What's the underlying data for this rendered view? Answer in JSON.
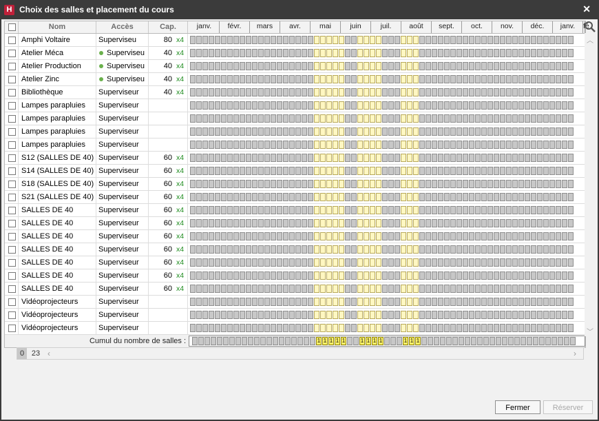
{
  "window": {
    "title": "Choix des salles et placement du cours",
    "app_icon": "H",
    "close_label": "✕"
  },
  "columns": {
    "name": "Nom",
    "access": "Accès",
    "capacity": "Cap."
  },
  "months": [
    "janv.",
    "févr.",
    "mars",
    "avr.",
    "mai",
    "juin",
    "juil.",
    "août",
    "sept.",
    "oct.",
    "nov.",
    "déc.",
    "janv.",
    "fé"
  ],
  "rows": [
    {
      "name": "Amphi Voltaire",
      "access": "Superviseu",
      "dot": false,
      "cap": "80",
      "mult": "x4",
      "active": true
    },
    {
      "name": "Atelier Méca",
      "access": "Superviseu",
      "dot": true,
      "cap": "40",
      "mult": "x4",
      "active": true
    },
    {
      "name": "Atelier Production",
      "access": "Superviseu",
      "dot": true,
      "cap": "40",
      "mult": "x4",
      "active": true
    },
    {
      "name": "Atelier Zinc",
      "access": "Superviseu",
      "dot": true,
      "cap": "40",
      "mult": "x4",
      "active": true
    },
    {
      "name": "Bibliothèque",
      "access": "Superviseur",
      "dot": false,
      "cap": "40",
      "mult": "x4",
      "active": true
    },
    {
      "name": "Lampes parapluies",
      "access": "Superviseur",
      "dot": false,
      "cap": "",
      "mult": "",
      "active": true
    },
    {
      "name": "Lampes parapluies",
      "access": "Superviseur",
      "dot": false,
      "cap": "",
      "mult": "",
      "active": true
    },
    {
      "name": "Lampes parapluies",
      "access": "Superviseur",
      "dot": false,
      "cap": "",
      "mult": "",
      "active": true
    },
    {
      "name": "Lampes parapluies",
      "access": "Superviseur",
      "dot": false,
      "cap": "",
      "mult": "",
      "active": true
    },
    {
      "name": "S12 (SALLES DE 40)",
      "access": "Superviseur",
      "dot": false,
      "cap": "60",
      "mult": "x4",
      "active": true
    },
    {
      "name": "S14 (SALLES DE 40)",
      "access": "Superviseur",
      "dot": false,
      "cap": "60",
      "mult": "x4",
      "active": true
    },
    {
      "name": "S18 (SALLES DE 40)",
      "access": "Superviseur",
      "dot": false,
      "cap": "60",
      "mult": "x4",
      "active": true
    },
    {
      "name": "S21 (SALLES DE 40)",
      "access": "Superviseur",
      "dot": false,
      "cap": "60",
      "mult": "x4",
      "active": true
    },
    {
      "name": "SALLES DE 40",
      "access": "Superviseur",
      "dot": false,
      "cap": "60",
      "mult": "x4",
      "active": true
    },
    {
      "name": "SALLES DE 40",
      "access": "Superviseur",
      "dot": false,
      "cap": "60",
      "mult": "x4",
      "active": true
    },
    {
      "name": "SALLES DE 40",
      "access": "Superviseur",
      "dot": false,
      "cap": "60",
      "mult": "x4",
      "active": true
    },
    {
      "name": "SALLES DE 40",
      "access": "Superviseur",
      "dot": false,
      "cap": "60",
      "mult": "x4",
      "active": true
    },
    {
      "name": "SALLES DE 40",
      "access": "Superviseur",
      "dot": false,
      "cap": "60",
      "mult": "x4",
      "active": true
    },
    {
      "name": "SALLES DE 40",
      "access": "Superviseur",
      "dot": false,
      "cap": "60",
      "mult": "x4",
      "active": true
    },
    {
      "name": "SALLES DE 40",
      "access": "Superviseur",
      "dot": false,
      "cap": "60",
      "mult": "x4",
      "active": true
    },
    {
      "name": "Vidéoprojecteurs",
      "access": "Superviseur",
      "dot": false,
      "cap": "",
      "mult": "",
      "active": true
    },
    {
      "name": "Vidéoprojecteurs",
      "access": "Superviseur",
      "dot": false,
      "cap": "",
      "mult": "",
      "active": true
    },
    {
      "name": "Vidéoprojecteurs",
      "access": "Superviseur",
      "dot": false,
      "cap": "",
      "mult": "",
      "active": true
    }
  ],
  "timeline": {
    "slot_count": 62,
    "highlighted_slots": [
      20,
      21,
      22,
      23,
      24,
      27,
      28,
      29,
      30,
      34,
      35,
      36
    ],
    "summary_value": "1"
  },
  "summary": {
    "label": "Cumul du nombre de salles :"
  },
  "bottom_tabs": [
    "0",
    "23"
  ],
  "buttons": {
    "close": "Fermer",
    "reserve": "Réserver"
  },
  "colors": {
    "slot_off": "#c8c8c8",
    "slot_on": "#fff7c2",
    "summary_on": "#fff46a",
    "capacity_mult": "#1f8c1f",
    "access_dot": "#6ab04c"
  }
}
